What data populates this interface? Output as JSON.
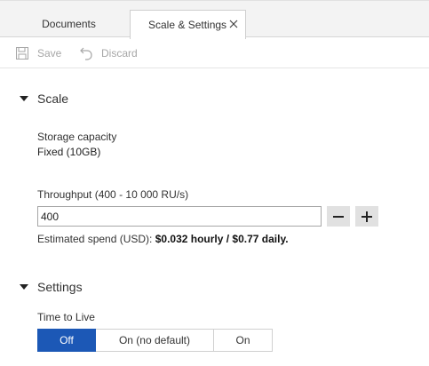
{
  "tabs": {
    "documents": "Documents",
    "scale_settings": "Scale & Settings"
  },
  "toolbar": {
    "save": "Save",
    "discard": "Discard"
  },
  "scale": {
    "heading": "Scale",
    "storage_label": "Storage capacity",
    "storage_value": "Fixed (10GB)",
    "throughput_label": "Throughput (400 - 10 000 RU/s)",
    "throughput_value": "400",
    "spend_prefix": "Estimated spend (USD): ",
    "spend_value": "$0.032 hourly / $0.77 daily."
  },
  "settings": {
    "heading": "Settings",
    "ttl_label": "Time to Live",
    "ttl_options": [
      "Off",
      "On (no default)",
      "On"
    ],
    "ttl_selected": "Off"
  },
  "colors": {
    "accent": "#1c58b6",
    "disabled_text": "#a6a6a6"
  },
  "icons": {
    "save": "save-icon",
    "discard": "undo-icon",
    "close": "close-icon",
    "minus": "minus-icon",
    "plus": "plus-icon"
  }
}
